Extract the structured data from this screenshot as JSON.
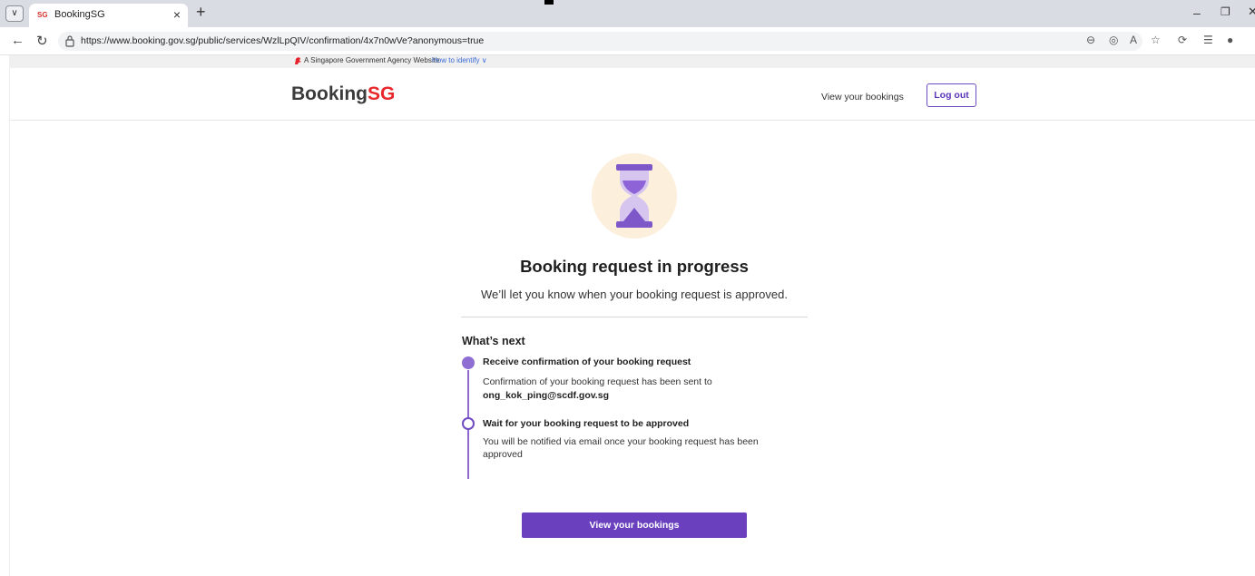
{
  "browser": {
    "tab_title": "BookingSG",
    "tab_favicon": "SG",
    "tab_close": "×",
    "new_tab": "+",
    "url": "https://www.booking.gov.sg/public/services/WzlLpQIV/confirmation/4x7n0wVe?anonymous=true",
    "win_min": "–",
    "win_max": "❐",
    "win_close": "✕"
  },
  "gov_banner": {
    "text": "A Singapore Government Agency Website",
    "link": "How to identify ∨"
  },
  "header": {
    "logo_main": "Booking",
    "logo_accent": "SG",
    "nav_bookings": "View your bookings",
    "logout": "Log out"
  },
  "main": {
    "title": "Booking request in progress",
    "subtitle": "We’ll let you know when your booking request is approved.",
    "next_heading": "What’s next",
    "steps": [
      {
        "title": "Receive confirmation of your booking request",
        "desc": "Confirmation of your booking request has been sent to",
        "email": "ong_kok_ping@scdf.gov.sg"
      },
      {
        "title": "Wait for your booking request to be approved",
        "desc": "You will be notified via email once your booking request has been approved"
      }
    ],
    "primary_button": "View your bookings"
  },
  "colors": {
    "accent": "#6a40bf",
    "brand_red": "#e8282c",
    "hero_bg": "#fcefdc"
  }
}
